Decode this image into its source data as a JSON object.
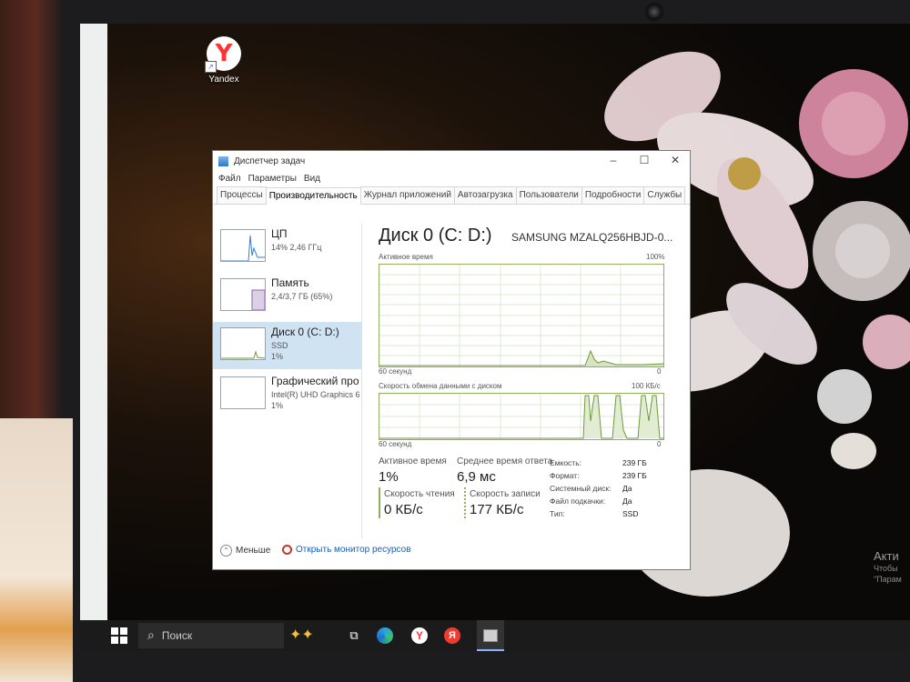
{
  "desktop": {
    "icon_label": "Yandex",
    "activation": {
      "title": "Акти",
      "line1": "Чтобы",
      "line2": "\"Парам"
    }
  },
  "window": {
    "title": "Диспетчер задач",
    "controls": {
      "minimize": "–",
      "maximize": "☐",
      "close": "✕"
    }
  },
  "menu": [
    "Файл",
    "Параметры",
    "Вид"
  ],
  "tabs": [
    {
      "label": "Процессы",
      "active": false
    },
    {
      "label": "Производительность",
      "active": true
    },
    {
      "label": "Журнал приложений",
      "active": false
    },
    {
      "label": "Автозагрузка",
      "active": false
    },
    {
      "label": "Пользователи",
      "active": false
    },
    {
      "label": "Подробности",
      "active": false
    },
    {
      "label": "Службы",
      "active": false
    }
  ],
  "resources": [
    {
      "name": "ЦП",
      "line2": "14% 2,46 ГГц",
      "line3": "",
      "active": false
    },
    {
      "name": "Память",
      "line2": "2,4/3,7 ГБ (65%)",
      "line3": "",
      "active": false
    },
    {
      "name": "Диск 0 (C: D:)",
      "line2": "SSD",
      "line3": "1%",
      "active": true
    },
    {
      "name": "Графический про",
      "line2": "Intel(R) UHD Graphics 6",
      "line3": "1%",
      "active": false
    }
  ],
  "disk": {
    "title": "Диск 0 (C: D:)",
    "model": "SAMSUNG MZALQ256HBJD-0...",
    "graph1": {
      "label": "Активное время",
      "max": "100%",
      "time": "60 секунд",
      "min": "0"
    },
    "graph2": {
      "label": "Скорость обмена данными с диском",
      "max": "100 КБ/с",
      "time": "60 секунд",
      "min": "0"
    },
    "stats": {
      "active_time_label": "Активное время",
      "active_time": "1%",
      "avg_response_label": "Среднее время ответа",
      "avg_response": "6,9 мс",
      "read_label": "Скорость чтения",
      "read": "0 КБ/с",
      "write_label": "Скорость записи",
      "write": "177 КБ/с"
    },
    "props": [
      {
        "label": "Емкость:",
        "value": "239 ГБ"
      },
      {
        "label": "Формат:",
        "value": "239 ГБ"
      },
      {
        "label": "Системный диск:",
        "value": "Да"
      },
      {
        "label": "Файл подкачки:",
        "value": "Да"
      },
      {
        "label": "Тип:",
        "value": "SSD"
      }
    ]
  },
  "footer": {
    "fewer": "Меньше",
    "resmon": "Открыть монитор ресурсов"
  },
  "taskbar": {
    "search_placeholder": "Поиск",
    "yandex_browser": "Y",
    "yandex_app": "Я"
  },
  "colors": {
    "accent_graph": "#8fb05a",
    "selection": "#cfe3f3",
    "link": "#1a5fb4"
  }
}
